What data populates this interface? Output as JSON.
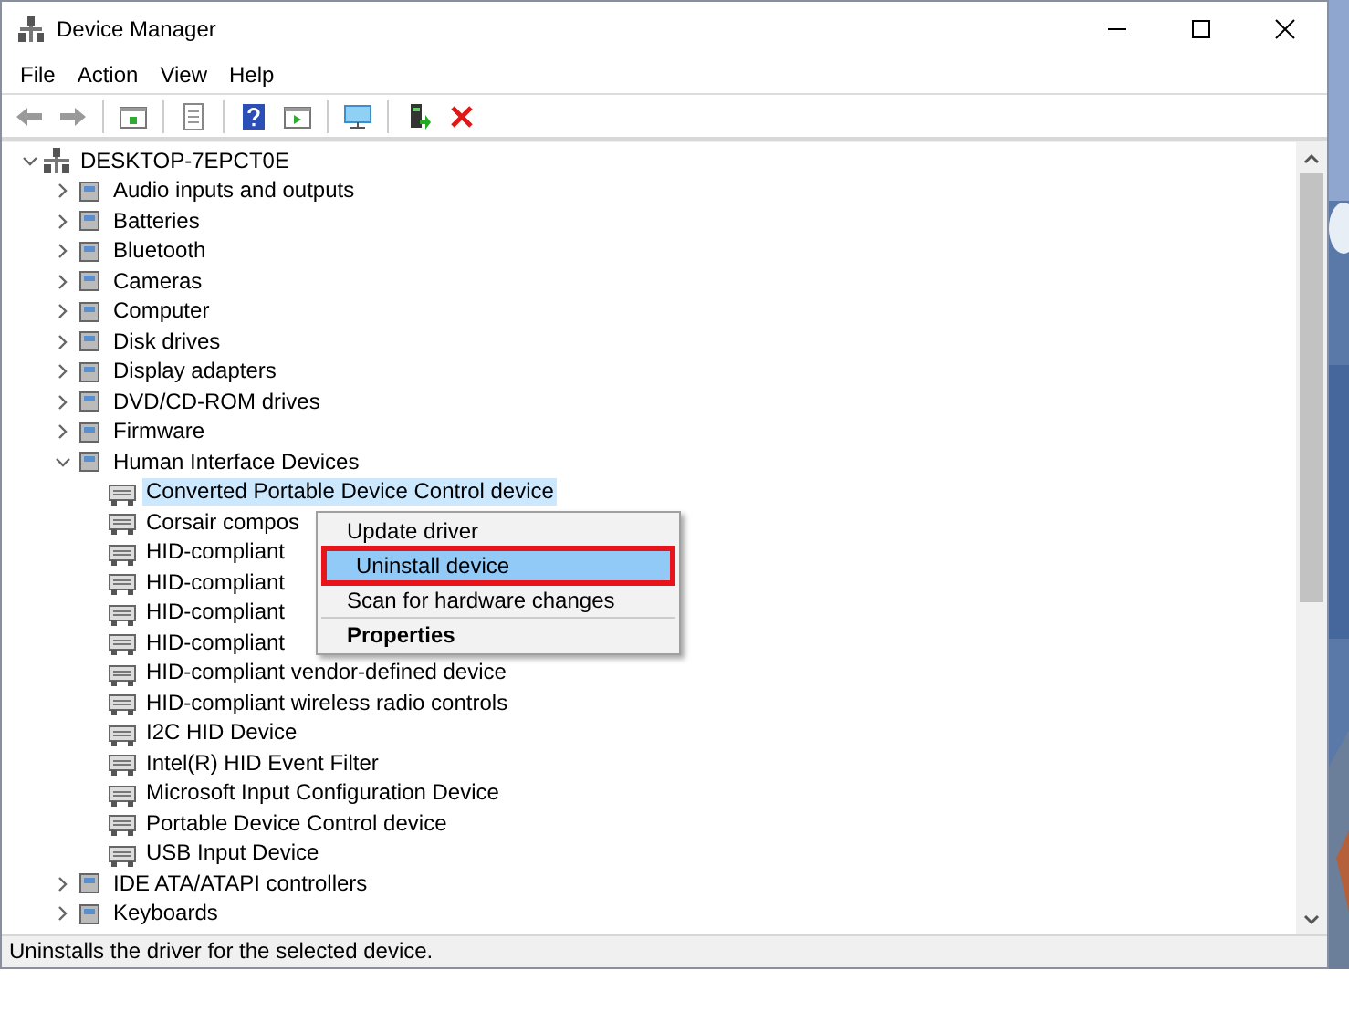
{
  "window": {
    "title": "Device Manager"
  },
  "menu": [
    "File",
    "Action",
    "View",
    "Help"
  ],
  "toolbar": [
    {
      "kind": "back",
      "disabled": true
    },
    {
      "kind": "forward",
      "disabled": true
    },
    {
      "kind": "separator"
    },
    {
      "kind": "console"
    },
    {
      "kind": "separator"
    },
    {
      "kind": "properties"
    },
    {
      "kind": "separator"
    },
    {
      "kind": "help"
    },
    {
      "kind": "view"
    },
    {
      "kind": "separator"
    },
    {
      "kind": "scan"
    },
    {
      "kind": "separator"
    },
    {
      "kind": "enable"
    },
    {
      "kind": "uninstall"
    }
  ],
  "tree": {
    "label": "DESKTOP-7EPCT0E",
    "expanded": true,
    "children": [
      {
        "label": "Audio inputs and outputs",
        "expanded": false
      },
      {
        "label": "Batteries",
        "expanded": false
      },
      {
        "label": "Bluetooth",
        "expanded": false
      },
      {
        "label": "Cameras",
        "expanded": false
      },
      {
        "label": "Computer",
        "expanded": false
      },
      {
        "label": "Disk drives",
        "expanded": false
      },
      {
        "label": "Display adapters",
        "expanded": false
      },
      {
        "label": "DVD/CD-ROM drives",
        "expanded": false
      },
      {
        "label": "Firmware",
        "expanded": false
      },
      {
        "label": "Human Interface Devices",
        "expanded": true,
        "children": [
          {
            "label": "Converted Portable Device Control device",
            "selected": true
          },
          {
            "label": "Corsair compos",
            "selected": false
          },
          {
            "label": "HID-compliant",
            "selected": false
          },
          {
            "label": "HID-compliant",
            "selected": false
          },
          {
            "label": "HID-compliant",
            "selected": false
          },
          {
            "label": "HID-compliant",
            "selected": false
          },
          {
            "label": "HID-compliant vendor-defined device",
            "selected": false
          },
          {
            "label": "HID-compliant wireless radio controls",
            "selected": false
          },
          {
            "label": "I2C HID Device",
            "selected": false
          },
          {
            "label": "Intel(R) HID Event Filter",
            "selected": false
          },
          {
            "label": "Microsoft Input Configuration Device",
            "selected": false
          },
          {
            "label": "Portable Device Control device",
            "selected": false
          },
          {
            "label": "USB Input Device",
            "selected": false
          }
        ]
      },
      {
        "label": "IDE ATA/ATAPI controllers",
        "expanded": false
      },
      {
        "label": "Keyboards",
        "expanded": false
      }
    ]
  },
  "context_menu": [
    {
      "kind": "item",
      "label": "Update driver",
      "selected": false,
      "annotated": false
    },
    {
      "kind": "item",
      "label": "Uninstall device",
      "selected": true,
      "annotated": true
    },
    {
      "kind": "item",
      "label": "Scan for hardware changes",
      "selected": false,
      "annotated": false
    },
    {
      "kind": "separator"
    },
    {
      "kind": "default",
      "label": "Properties",
      "selected": false,
      "annotated": false
    }
  ],
  "status_bar": "Uninstalls the driver for the selected device."
}
